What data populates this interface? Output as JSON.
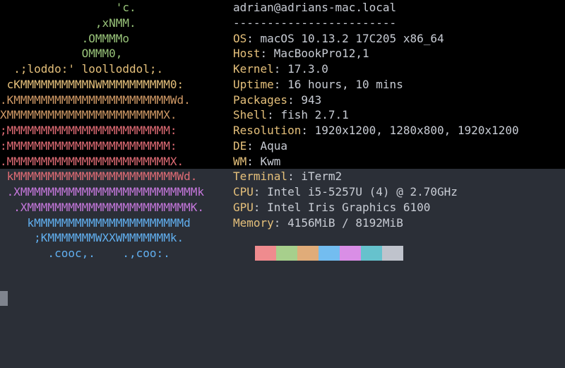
{
  "logo": {
    "lines": [
      {
        "text": "                 'c.",
        "color": "#98c379"
      },
      {
        "text": "              ,xNMM.",
        "color": "#98c379"
      },
      {
        "text": "            .OMMMMo",
        "color": "#98c379"
      },
      {
        "text": "            OMMM0,",
        "color": "#98c379"
      },
      {
        "text": "  .;loddo:' loolloddol;.",
        "color": "#e5c07b"
      },
      {
        "text": " cKMMMMMMMMMMNWMMMMMMMMMM0:",
        "color": "#e5c07b"
      },
      {
        "text": ".KMMMMMMMMMMMMMMMMMMMMMMMWd.",
        "color": "#d19a66"
      },
      {
        "text": "XMMMMMMMMMMMMMMMMMMMMMMMX.",
        "color": "#d19a66"
      },
      {
        "text": ";MMMMMMMMMMMMMMMMMMMMMMMM:",
        "color": "#e06c75"
      },
      {
        "text": ":MMMMMMMMMMMMMMMMMMMMMMMM:",
        "color": "#e06c75"
      },
      {
        "text": ".MMMMMMMMMMMMMMMMMMMMMMMMX.",
        "color": "#e06c75"
      },
      {
        "text": " kMMMMMMMMMMMMMMMMMMMMMMMMWd.",
        "color": "#e06c75"
      },
      {
        "text": " .XMMMMMMMMMMMMMMMMMMMMMMMMMMk",
        "color": "#c678dd"
      },
      {
        "text": "  .XMMMMMMMMMMMMMMMMMMMMMMMMK.",
        "color": "#c678dd"
      },
      {
        "text": "    kMMMMMMMMMMMMMMMMMMMMMMd",
        "color": "#61afef"
      },
      {
        "text": "     ;KMMMMMMMWXXWMMMMMMMk.",
        "color": "#61afef"
      },
      {
        "text": "       .cooc,.    .,coo:.",
        "color": "#61afef"
      }
    ]
  },
  "info": {
    "header": "adrian@adrians-mac.local",
    "separator": "------------------------",
    "rows": [
      {
        "key": "OS",
        "value": "macOS 10.13.2 17C205 x86_64"
      },
      {
        "key": "Host",
        "value": "MacBookPro12,1"
      },
      {
        "key": "Kernel",
        "value": "17.3.0"
      },
      {
        "key": "Uptime",
        "value": "16 hours, 10 mins"
      },
      {
        "key": "Packages",
        "value": "943"
      },
      {
        "key": "Shell",
        "value": "fish 2.7.1"
      },
      {
        "key": "Resolution",
        "value": "1920x1200, 1280x800, 1920x1200"
      },
      {
        "key": "DE",
        "value": "Aqua"
      },
      {
        "key": "WM",
        "value": "Kwm"
      },
      {
        "key": "Terminal",
        "value": "iTerm2"
      },
      {
        "key": "CPU",
        "value": "Intel i5-5257U (4) @ 2.70GHz"
      },
      {
        "key": "GPU",
        "value": "Intel Iris Graphics 6100"
      },
      {
        "key": "Memory",
        "value": "4156MiB / 8192MiB"
      }
    ]
  },
  "palette": [
    "#ef8b8e",
    "#a7cf8c",
    "#e0ac79",
    "#73bdf0",
    "#d98ee6",
    "#66c2cd",
    "#bfc3cc"
  ],
  "colors": {
    "background": "#2b2f37",
    "top_band": "#000000",
    "key": "#e5c07b",
    "user": "#98c379",
    "text": "#c8ccd4"
  }
}
